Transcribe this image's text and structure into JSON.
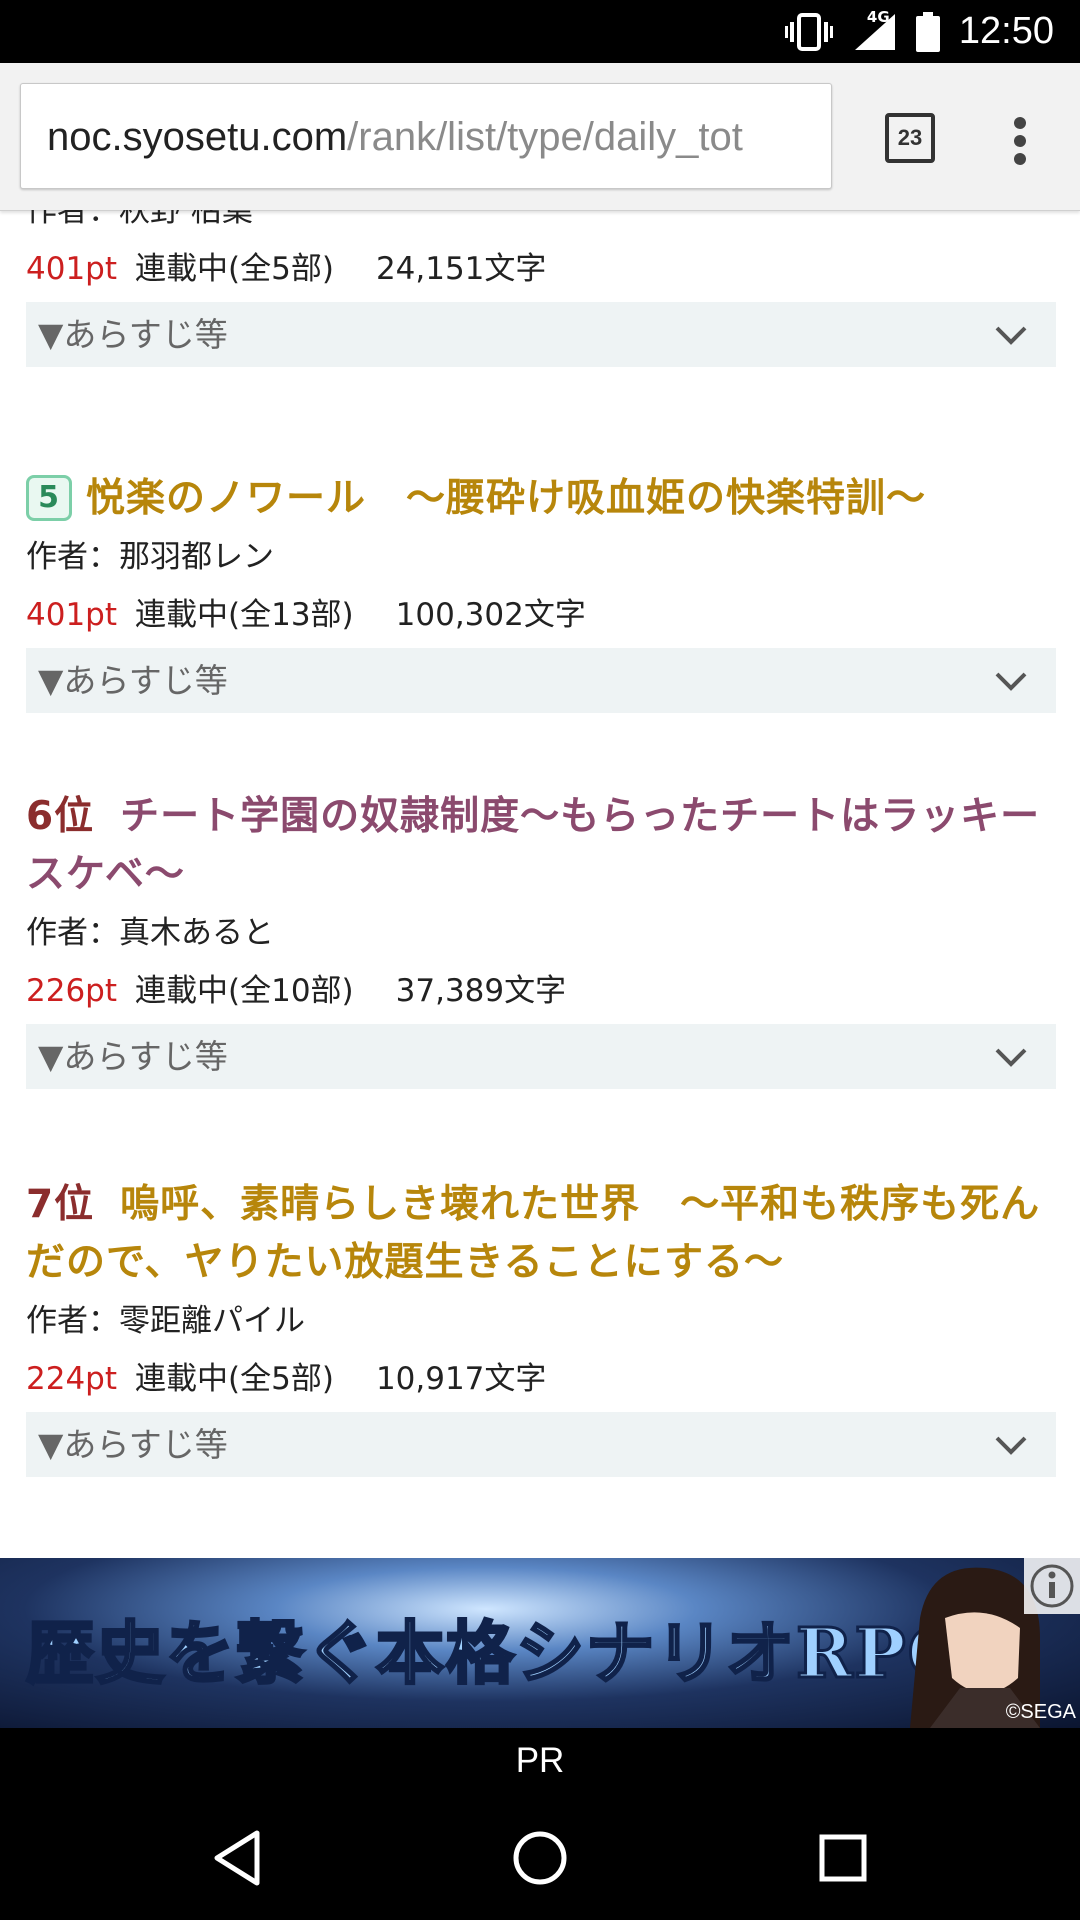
{
  "status_bar": {
    "network": "4G",
    "time": "12:50"
  },
  "browser": {
    "url_host": "noc.syosetu.com",
    "url_path": "/rank/list/type/daily_tot",
    "tab_count": "23"
  },
  "entries": [
    {
      "rank": "",
      "title": "",
      "author": "作者：秋野 枯葉",
      "points": "401pt",
      "status": "連載中(全5部)",
      "chars": "24,151文字",
      "summary_label": "▼あらすじ等"
    },
    {
      "rank": "5",
      "title": "悦楽のノワール　～腰砕け吸血姫の快楽特訓～",
      "author": "作者：那羽都レン",
      "points": "401pt",
      "status": "連載中(全13部)",
      "chars": "100,302文字",
      "summary_label": "▼あらすじ等"
    },
    {
      "rank": "6位",
      "title": "チート学園の奴隷制度～もらったチートはラッキースケベ～",
      "author": "作者：真木あると",
      "points": "226pt",
      "status": "連載中(全10部)",
      "chars": "37,389文字",
      "summary_label": "▼あらすじ等"
    },
    {
      "rank": "7位",
      "title": "嗚呼、素晴らしき壊れた世界　～平和も秩序も死んだので、ヤりたい放題生きることにする～",
      "author": "作者：零距離パイル",
      "points": "224pt",
      "status": "連載中(全5部)",
      "chars": "10,917文字",
      "summary_label": "▼あらすじ等"
    }
  ],
  "ad": {
    "text": "歴史を繋ぐ本格シナリオRPG",
    "credit": "©SEGA",
    "label": "PR"
  },
  "colors": {
    "points": "#cc1f1f",
    "title_gold": "#b7860b",
    "title_purple": "#8b4a6e",
    "rank": "#8b2d2d"
  }
}
